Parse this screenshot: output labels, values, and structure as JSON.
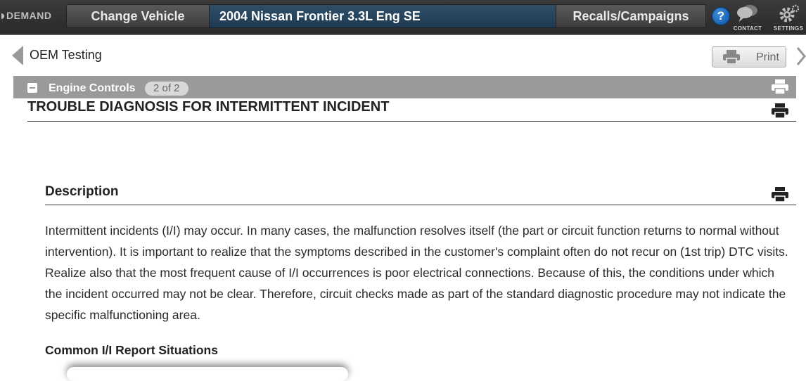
{
  "topbar": {
    "brand": "DEMAND",
    "change_vehicle_label": "Change Vehicle",
    "vehicle_name": "2004 Nissan Frontier 3.3L Eng SE",
    "recalls_label": "Recalls/Campaigns",
    "help_label": "?",
    "contact_label": "CONTACT",
    "settings_label": "SETTINGS",
    "icons": [
      "help-icon",
      "contact-icon",
      "settings-icon"
    ]
  },
  "subbar": {
    "section_title": "OEM Testing",
    "print_label": "Print",
    "icons": [
      "chevron-left-icon",
      "printer-icon",
      "chevron-right-icon"
    ]
  },
  "group": {
    "label": "Engine Controls",
    "counter": "2 of 2"
  },
  "document": {
    "title": "TROUBLE DIAGNOSIS FOR INTERMITTENT INCIDENT",
    "description_heading": "Description",
    "description_body": "Intermittent incidents (I/I) may occur. In many cases, the malfunction resolves itself (the part or circuit function returns to normal without intervention). It is important to realize that the symptoms described in the customer's complaint often do not recur on (1st trip) DTC visits. Realize also that the most frequent cause of I/I occurrences is poor electrical connections. Because of this, the conditions under which the incident occurred may not be clear. Therefore, circuit checks made as part of the standard diagnostic procedure may not indicate the specific malfunctioning area.",
    "subheading": "Common I/I Report Situations"
  },
  "colors": {
    "topbar_bg": "#2f2f2f",
    "vehicle_bg": "#1e3a52",
    "group_bar_bg": "#9a9a9a",
    "help_blue": "#0b4f9c"
  }
}
